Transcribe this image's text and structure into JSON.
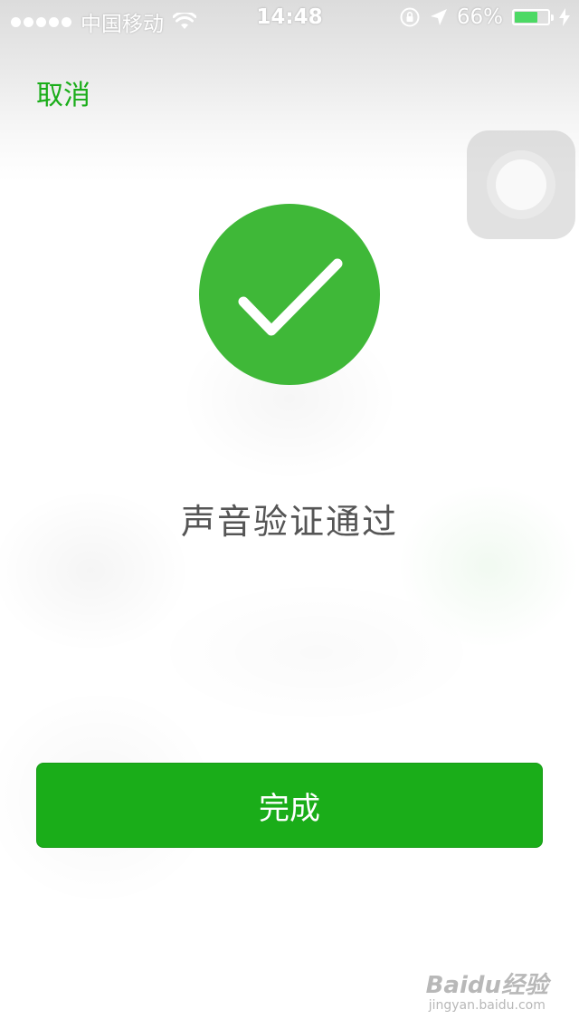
{
  "status_bar": {
    "carrier": "中国移动",
    "time": "14:48",
    "battery": "66%",
    "battery_level": 0.66,
    "icons": [
      "signal-dots-icon",
      "wifi-icon",
      "rotation-lock-icon",
      "location-arrow-icon",
      "battery-icon",
      "charging-bolt-icon"
    ]
  },
  "nav": {
    "cancel_label": "取消"
  },
  "floating_button": {
    "icon": "assistive-touch-icon"
  },
  "result": {
    "icon": "check-circle-icon",
    "message": "声音验证通过"
  },
  "actions": {
    "done_label": "完成"
  },
  "watermark": {
    "brand": "Baidu经验",
    "url": "jingyan.baidu.com"
  },
  "colors": {
    "accent": "#1aad19",
    "success_circle": "#3fb838",
    "battery_fill": "#4cd964",
    "message_text": "#555555"
  }
}
